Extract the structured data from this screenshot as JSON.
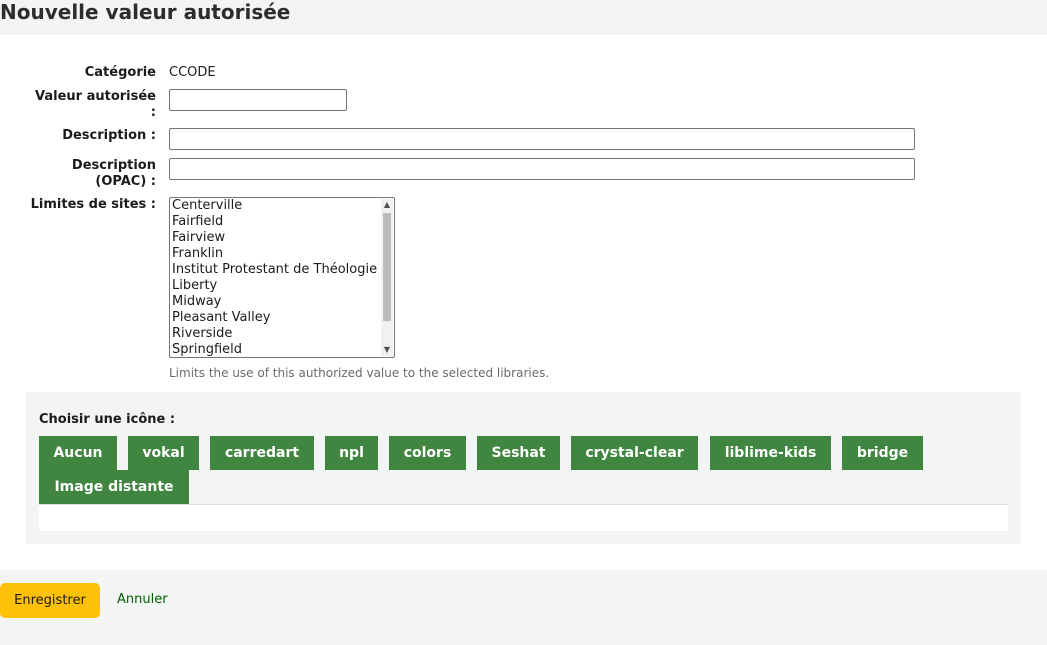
{
  "page": {
    "title": "Nouvelle valeur autorisée"
  },
  "form": {
    "category_label": "Catégorie",
    "category_value": "CCODE",
    "authorised_value_label_line1": "Valeur autorisée",
    "authorised_value_label_line2": ":",
    "authorised_value": "",
    "description_label": "Description :",
    "description_value": "",
    "opac_description_label_line1": "Description",
    "opac_description_label_line2": "(OPAC) :",
    "opac_description_value": "",
    "branch_limits_label": "Limites de sites :",
    "branches": [
      "Centerville",
      "Fairfield",
      "Fairview",
      "Franklin",
      "Institut Protestant de Théologie",
      "Liberty",
      "Midway",
      "Pleasant Valley",
      "Riverside",
      "Springfield"
    ],
    "branch_limits_hint": "Limits the use of this authorized value to the selected libraries."
  },
  "icons": {
    "label": "Choisir une icône :",
    "tabs": [
      "Aucun",
      "vokal",
      "carredart",
      "npl",
      "colors",
      "Seshat",
      "crystal-clear",
      "liblime-kids",
      "bridge",
      "Image distante"
    ]
  },
  "actions": {
    "save_label": "Enregistrer",
    "cancel_label": "Annuler"
  },
  "colors": {
    "tab_green": "#408540",
    "save_yellow": "#ffc107",
    "link_green": "#006100",
    "background": "#f3f4f4"
  }
}
